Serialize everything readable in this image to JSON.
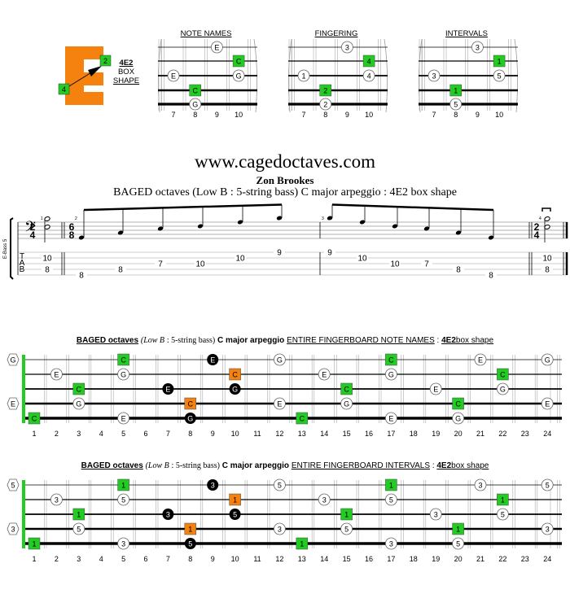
{
  "logo": {
    "letter": "E",
    "shape_label": "4E2",
    "box": "BOX",
    "shape": "SHAPE",
    "from_finger": "4",
    "to_finger": "2",
    "color": "#f5820f"
  },
  "colors": {
    "green": "#22cc22",
    "orange": "#f5820f",
    "black": "#000000",
    "white": "#ffffff"
  },
  "diagrams": [
    {
      "title": "NOTE NAMES",
      "markers": [
        {
          "s": 0,
          "f": 9,
          "l": "E",
          "t": "wc"
        },
        {
          "s": 1,
          "f": 10,
          "l": "C",
          "t": "sq"
        },
        {
          "s": 2,
          "f": 7,
          "l": "E",
          "t": "wc"
        },
        {
          "s": 2,
          "f": 10,
          "l": "G",
          "t": "wc"
        },
        {
          "s": 3,
          "f": 8,
          "l": "C",
          "t": "sq"
        },
        {
          "s": 4,
          "f": 8,
          "l": "G",
          "t": "wc"
        }
      ]
    },
    {
      "title": "FINGERING",
      "markers": [
        {
          "s": 0,
          "f": 9,
          "l": "3",
          "t": "wc"
        },
        {
          "s": 1,
          "f": 10,
          "l": "4",
          "t": "sq"
        },
        {
          "s": 2,
          "f": 7,
          "l": "1",
          "t": "wc"
        },
        {
          "s": 2,
          "f": 10,
          "l": "4",
          "t": "wc"
        },
        {
          "s": 3,
          "f": 8,
          "l": "2",
          "t": "sq"
        },
        {
          "s": 4,
          "f": 8,
          "l": "2",
          "t": "wc"
        }
      ]
    },
    {
      "title": "INTERVALS",
      "markers": [
        {
          "s": 0,
          "f": 9,
          "l": "3",
          "t": "wc"
        },
        {
          "s": 1,
          "f": 10,
          "l": "1",
          "t": "sq"
        },
        {
          "s": 2,
          "f": 7,
          "l": "3",
          "t": "wc"
        },
        {
          "s": 2,
          "f": 10,
          "l": "5",
          "t": "wc"
        },
        {
          "s": 3,
          "f": 8,
          "l": "1",
          "t": "sq"
        },
        {
          "s": 4,
          "f": 8,
          "l": "5",
          "t": "wc"
        }
      ]
    }
  ],
  "diagram_frets": [
    "7",
    "8",
    "9",
    "10"
  ],
  "score": {
    "site": "www.cagedoctaves.com",
    "composer": "Zon Brookes",
    "subtitle": "BAGED octaves (Low B : 5-string bass) C major arpeggio : 4E2 box shape",
    "instrument": "E-Bass 5",
    "tab_letters": [
      "T",
      "A",
      "B"
    ],
    "time_sigs": [
      {
        "top": "2",
        "bottom": "4"
      },
      {
        "top": "6",
        "bottom": "8"
      },
      {
        "top": "2",
        "bottom": "4"
      }
    ],
    "measure_numbers": [
      "1",
      "2",
      "3",
      "4"
    ],
    "tab": [
      [
        {
          "l": 1,
          "v": "10"
        },
        {
          "l": 3,
          "v": "8"
        }
      ],
      [
        {
          "l": 4,
          "v": "8"
        },
        {
          "l": 3,
          "v": "8"
        },
        {
          "l": 2,
          "v": "7"
        },
        {
          "l": 2,
          "v": "10"
        },
        {
          "l": 1,
          "v": "10"
        },
        {
          "l": 0,
          "v": "9"
        }
      ],
      [
        {
          "l": 0,
          "v": "9"
        },
        {
          "l": 1,
          "v": "10"
        },
        {
          "l": 2,
          "v": "10"
        },
        {
          "l": 2,
          "v": "7"
        },
        {
          "l": 3,
          "v": "8"
        },
        {
          "l": 4,
          "v": "8"
        }
      ],
      [
        {
          "l": 1,
          "v": "10"
        },
        {
          "l": 3,
          "v": "8"
        }
      ]
    ]
  },
  "fingerboards": [
    {
      "title": {
        "a": "BAGED octaves",
        "b": "(",
        "c": "Low B",
        "d": ": 5-string bass)",
        "e": "C major arpeggio",
        "f": "ENTIRE FINGERBOARD  NOTE NAMES",
        "g": ":",
        "h": "4E2",
        "k": "box shape"
      },
      "label_key": "n"
    },
    {
      "title": {
        "a": "BAGED octaves",
        "b": "(",
        "c": "Low B",
        "d": ": 5-string bass)",
        "e": "C major arpeggio",
        "f": "ENTIRE FINGERBOARD  INTERVALS",
        "g": ":",
        "h": "4E2",
        "k": "box shape"
      },
      "label_key": "i"
    }
  ],
  "fret_numbers": [
    "1",
    "2",
    "3",
    "4",
    "5",
    "6",
    "7",
    "8",
    "9",
    "10",
    "11",
    "12",
    "13",
    "14",
    "15",
    "16",
    "17",
    "18",
    "19",
    "20",
    "21",
    "22",
    "23",
    "24"
  ],
  "markers": [
    {
      "s": 0,
      "f": 0,
      "n": "G",
      "i": "5",
      "t": "hex"
    },
    {
      "s": 0,
      "f": 5,
      "n": "C",
      "i": "1",
      "t": "sq"
    },
    {
      "s": 0,
      "f": 9,
      "n": "E",
      "i": "3",
      "t": "bk"
    },
    {
      "s": 0,
      "f": 12,
      "n": "G",
      "i": "5",
      "t": "wc"
    },
    {
      "s": 0,
      "f": 17,
      "n": "C",
      "i": "1",
      "t": "sq"
    },
    {
      "s": 0,
      "f": 21,
      "n": "E",
      "i": "3",
      "t": "wc"
    },
    {
      "s": 0,
      "f": 24,
      "n": "G",
      "i": "5",
      "t": "wc"
    },
    {
      "s": 1,
      "f": 2,
      "n": "E",
      "i": "3",
      "t": "wc"
    },
    {
      "s": 1,
      "f": 5,
      "n": "G",
      "i": "5",
      "t": "wc"
    },
    {
      "s": 1,
      "f": 10,
      "n": "C",
      "i": "1",
      "t": "or"
    },
    {
      "s": 1,
      "f": 14,
      "n": "E",
      "i": "3",
      "t": "wc"
    },
    {
      "s": 1,
      "f": 17,
      "n": "G",
      "i": "5",
      "t": "wc"
    },
    {
      "s": 1,
      "f": 22,
      "n": "C",
      "i": "1",
      "t": "sq"
    },
    {
      "s": 2,
      "f": 3,
      "n": "C",
      "i": "1",
      "t": "sq"
    },
    {
      "s": 2,
      "f": 7,
      "n": "E",
      "i": "3",
      "t": "bk"
    },
    {
      "s": 2,
      "f": 10,
      "n": "G",
      "i": "5",
      "t": "bk"
    },
    {
      "s": 2,
      "f": 15,
      "n": "C",
      "i": "1",
      "t": "sq"
    },
    {
      "s": 2,
      "f": 19,
      "n": "E",
      "i": "3",
      "t": "wc"
    },
    {
      "s": 2,
      "f": 22,
      "n": "G",
      "i": "5",
      "t": "wc"
    },
    {
      "s": 3,
      "f": 0,
      "n": "E",
      "i": "3",
      "t": "hex"
    },
    {
      "s": 3,
      "f": 3,
      "n": "G",
      "i": "5",
      "t": "wc"
    },
    {
      "s": 3,
      "f": 8,
      "n": "C",
      "i": "1",
      "t": "or"
    },
    {
      "s": 3,
      "f": 12,
      "n": "E",
      "i": "3",
      "t": "wc"
    },
    {
      "s": 3,
      "f": 15,
      "n": "G",
      "i": "5",
      "t": "wc"
    },
    {
      "s": 3,
      "f": 20,
      "n": "C",
      "i": "1",
      "t": "sq"
    },
    {
      "s": 3,
      "f": 24,
      "n": "E",
      "i": "3",
      "t": "wc"
    },
    {
      "s": 4,
      "f": 1,
      "n": "C",
      "i": "1",
      "t": "sq"
    },
    {
      "s": 4,
      "f": 5,
      "n": "E",
      "i": "3",
      "t": "wc"
    },
    {
      "s": 4,
      "f": 8,
      "n": "G",
      "i": "5",
      "t": "bk"
    },
    {
      "s": 4,
      "f": 13,
      "n": "C",
      "i": "1",
      "t": "sq"
    },
    {
      "s": 4,
      "f": 17,
      "n": "E",
      "i": "3",
      "t": "wc"
    },
    {
      "s": 4,
      "f": 20,
      "n": "G",
      "i": "5",
      "t": "wc"
    }
  ]
}
